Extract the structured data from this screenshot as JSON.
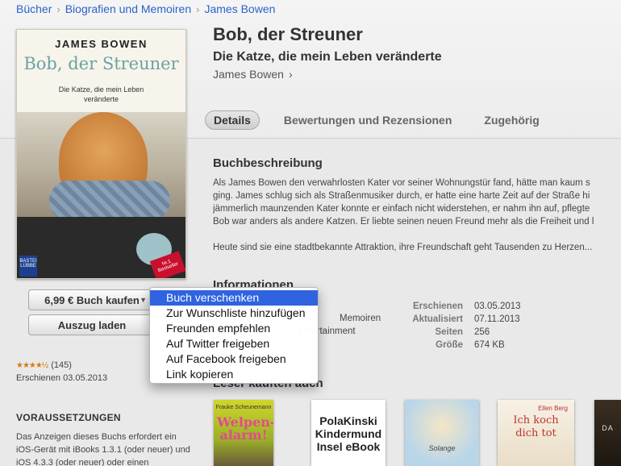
{
  "breadcrumb": [
    "Bücher",
    "Biografien und Memoiren",
    "James Bowen"
  ],
  "book": {
    "title": "Bob, der Streuner",
    "subtitle": "Die Katze, die mein Leben veränderte",
    "author": "James Bowen"
  },
  "cover": {
    "author": "JAMES BOWEN",
    "title": "Bob, der Streuner",
    "subtitle": "Die Katze, die mein Leben veränderte",
    "publisher_badge": "BASTEI LÜBBE",
    "bestseller_badge": "Nr.1 Bestseller"
  },
  "tabs": [
    {
      "label": "Details",
      "active": true
    },
    {
      "label": "Bewertungen und Rezensionen",
      "active": false
    },
    {
      "label": "Zugehörig",
      "active": false
    }
  ],
  "actions": {
    "buy_label": "6,99 € Buch kaufen",
    "sample_label": "Auszug laden"
  },
  "rating": {
    "stars": 4.5,
    "count": "(145)"
  },
  "released_left": "Erschienen 03.05.2013",
  "requirements": {
    "title": "VORAUSSETZUNGEN",
    "text": "Das Anzeigen dieses Buchs erfordert ein iOS-Gerät mit iBooks 1.3.1 (oder neuer) und iOS 4.3.3 (oder neuer) oder einen"
  },
  "description": {
    "title": "Buchbeschreibung",
    "lines": [
      "Als James Bowen den verwahrlosten Kater vor seiner Wohnungstür fand, hätte man kaum s",
      "ging. James schlug sich als Straßenmusiker durch, er hatte eine harte Zeit auf der Straße hi",
      "jämmerlich maunzenden Kater konnte er einfach nicht widerstehen, er nahm ihn auf, pflegte",
      "Bob war anders als andere Katzen. Er liebte seinen neuen Freund mehr als die Freiheit und l",
      "",
      "Heute sind sie eine stadtbekannte Attraktion, ihre Freundschaft geht Tausenden zu Herzen..."
    ]
  },
  "info": {
    "title": "Informationen",
    "left_lines": [
      "Memoiren",
      "Entertainment"
    ],
    "rows": [
      {
        "key": "Erschienen",
        "value": "03.05.2013"
      },
      {
        "key": "Aktualisiert",
        "value": "07.11.2013"
      },
      {
        "key": "Seiten",
        "value": "256"
      },
      {
        "key": "Größe",
        "value": "674 KB"
      }
    ]
  },
  "also_bought": {
    "title": "Leser kauften auch",
    "items": [
      {
        "author": "Frauke Scheunemann",
        "title": "Welpen-alarm!"
      },
      {
        "author": "",
        "title": "PolaKinski Kindermund Insel eBook"
      },
      {
        "author": "",
        "title": "Solange"
      },
      {
        "author": "Ellen Berg",
        "title": "Ich koch dich tot"
      },
      {
        "author": "",
        "title": "DA"
      }
    ]
  },
  "menu": {
    "items": [
      {
        "label": "Buch verschenken",
        "highlighted": true
      },
      {
        "label": "Zur Wunschliste hinzufügen",
        "highlighted": false
      },
      {
        "label": "Freunden empfehlen",
        "highlighted": false
      },
      {
        "label": "Auf Twitter freigeben",
        "highlighted": false
      },
      {
        "label": "Auf Facebook freigeben",
        "highlighted": false
      },
      {
        "label": "Link kopieren",
        "highlighted": false
      }
    ]
  },
  "colors": {
    "link": "#2b63c8",
    "menu_highlight": "#2f63e0",
    "star": "#d67a12"
  }
}
